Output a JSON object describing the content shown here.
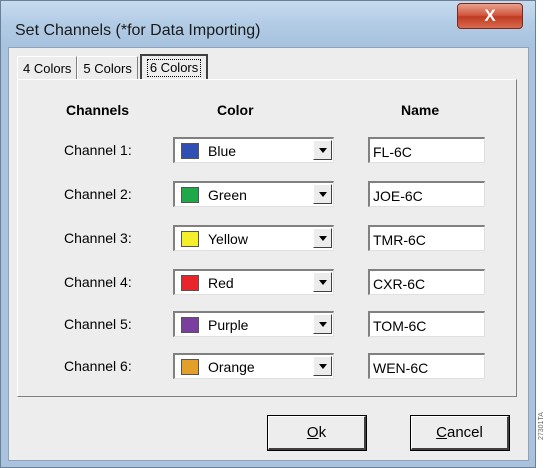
{
  "window": {
    "title": "Set Channels (*for  Data Importing)",
    "close_glyph": "X"
  },
  "tabs": [
    {
      "label": "4 Colors",
      "active": false
    },
    {
      "label": "5 Colors",
      "active": false
    },
    {
      "label": "6 Colors",
      "active": true
    }
  ],
  "headers": {
    "channels": "Channels",
    "color": "Color",
    "name": "Name"
  },
  "channels": [
    {
      "label": "Channel 1:",
      "color": "Blue",
      "swatch": "#2f4fb5",
      "name": "FL-6C"
    },
    {
      "label": "Channel 2:",
      "color": "Green",
      "swatch": "#1ea84a",
      "name": "JOE-6C"
    },
    {
      "label": "Channel 3:",
      "color": "Yellow",
      "swatch": "#f5ee2a",
      "name": "TMR-6C"
    },
    {
      "label": "Channel 4:",
      "color": "Red",
      "swatch": "#e8252a",
      "name": "CXR-6C"
    },
    {
      "label": "Channel 5:",
      "color": "Purple",
      "swatch": "#7a3f9e",
      "name": "TOM-6C"
    },
    {
      "label": "Channel 6:",
      "color": "Orange",
      "swatch": "#e2a02a",
      "name": "WEN-6C"
    }
  ],
  "buttons": {
    "ok_mnemonic": "O",
    "ok_rest": "k",
    "cancel_mnemonic": "C",
    "cancel_rest": "ancel"
  },
  "watermark": "27301TA"
}
